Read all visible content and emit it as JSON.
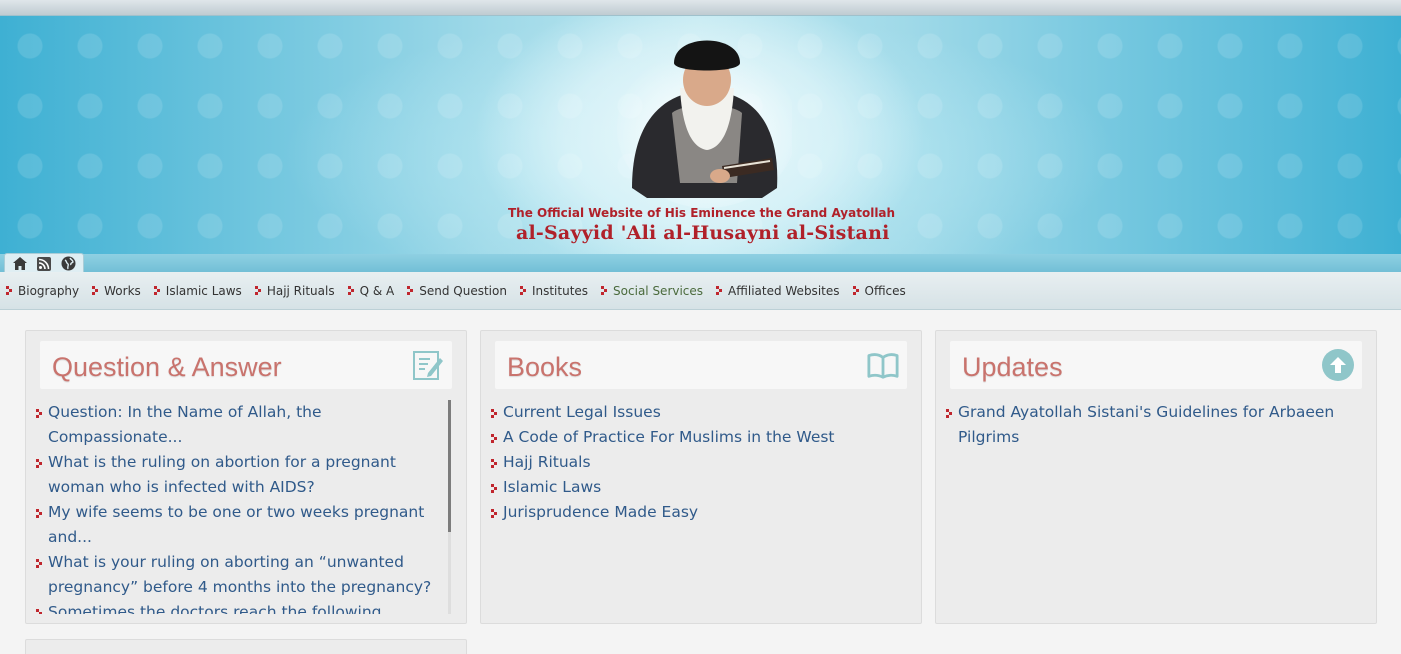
{
  "header": {
    "subtitle": "The Official Website of His Eminence the Grand Ayatollah",
    "title": "al-Sayyid 'Ali al-Husayni al-Sistani"
  },
  "toolbar": {
    "icons": [
      "home-icon",
      "rss-icon",
      "globe-icon"
    ]
  },
  "nav": {
    "items": [
      {
        "label": "Biography"
      },
      {
        "label": "Works"
      },
      {
        "label": "Islamic Laws"
      },
      {
        "label": "Hajj Rituals"
      },
      {
        "label": "Q & A"
      },
      {
        "label": "Send Question"
      },
      {
        "label": "Institutes"
      },
      {
        "label": "Social Services",
        "active": true
      },
      {
        "label": "Affiliated Websites"
      },
      {
        "label": "Offices"
      }
    ]
  },
  "panels": {
    "qa": {
      "title": "Question & Answer",
      "icon": "edit-icon",
      "items": [
        "Question: In the Name of Allah, the Compassionate...",
        "What is the ruling on abortion for a pregnant woman who is infected with AIDS?",
        "My wife seems to be one or two weeks pregnant and...",
        "What is your ruling on aborting an “unwanted pregnancy” before 4 months into the pregnancy?",
        "Sometimes the doctors reach the following"
      ]
    },
    "books": {
      "title": "Books",
      "icon": "book-icon",
      "items": [
        "Current Legal Issues",
        "A Code of Practice For Muslims in the West",
        "Hajj Rituals",
        "Islamic Laws",
        "Jurisprudence Made Easy"
      ]
    },
    "updates": {
      "title": "Updates",
      "icon": "arrow-up-circle-icon",
      "items": [
        "Grand Ayatollah Sistani's Guidelines for Arbaeen Pilgrims"
      ]
    }
  },
  "colors": {
    "accent_red": "#b0212a",
    "panel_title": "#c9736d",
    "link_blue": "#305a8a",
    "banner_blue": "#3eb0d3"
  }
}
